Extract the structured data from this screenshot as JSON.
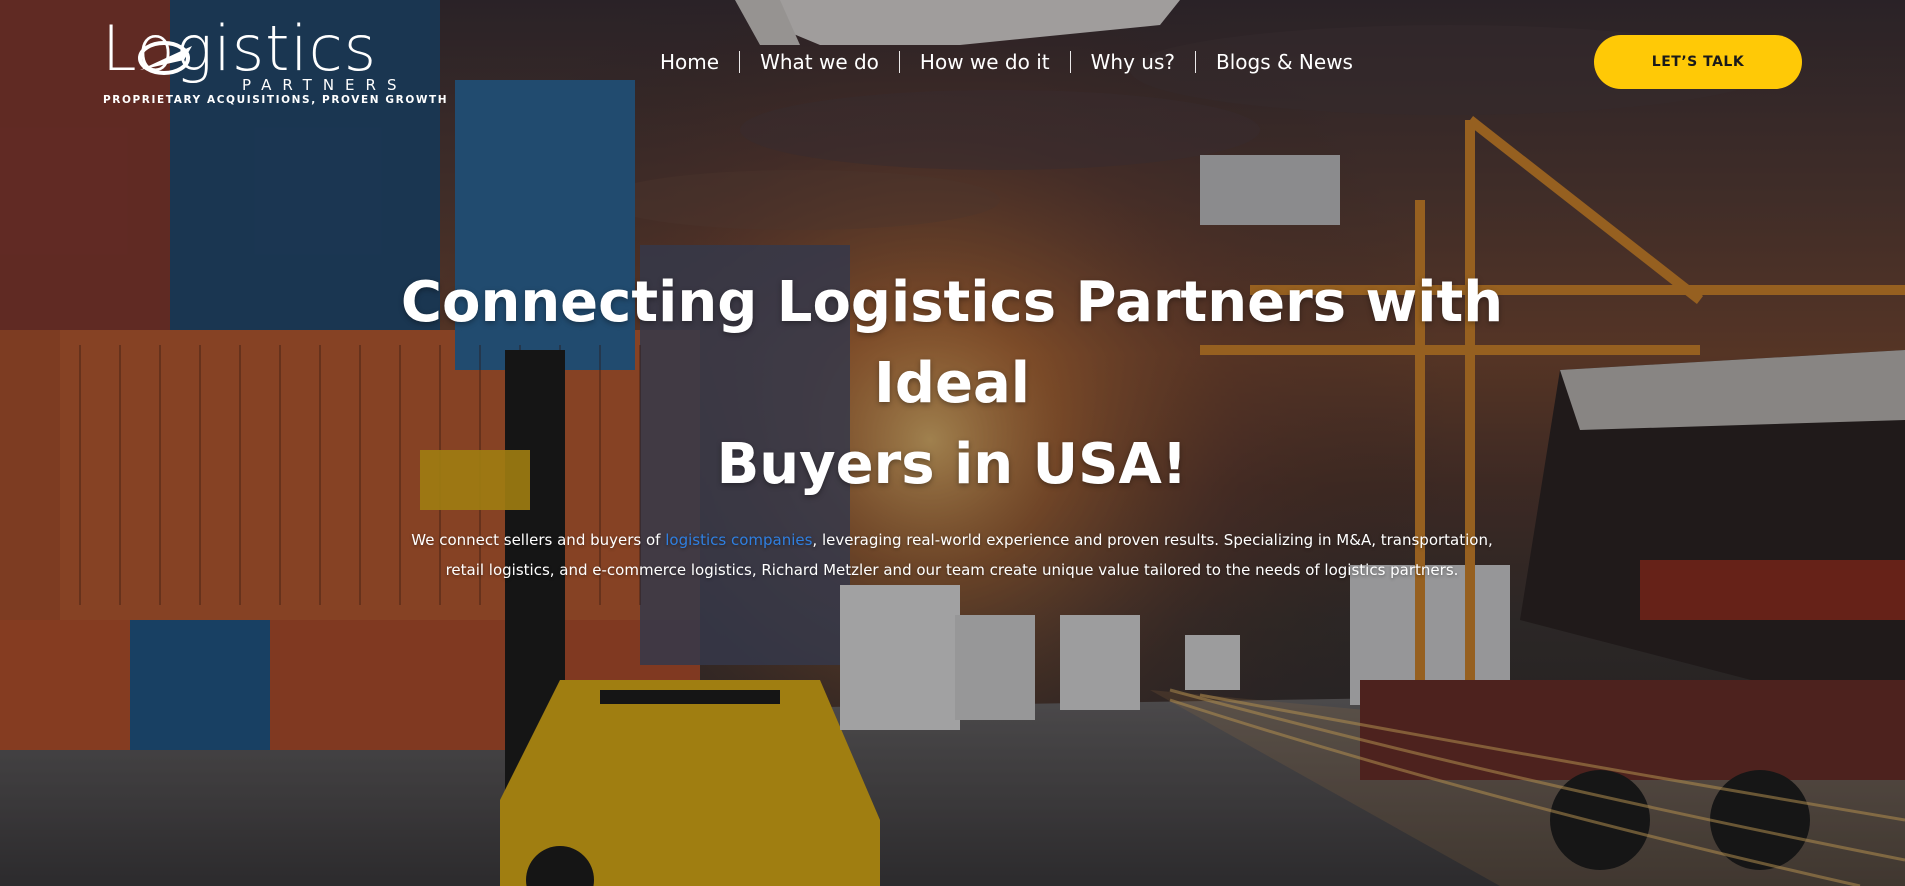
{
  "logo": {
    "wordmark": "Logistics",
    "subtitle": "PARTNERS",
    "tagline": "PROPRIETARY ACQUISITIONS, PROVEN GROWTH",
    "icon": "swoosh-plane-icon"
  },
  "nav": {
    "items": [
      {
        "label": "Home"
      },
      {
        "label": "What we do"
      },
      {
        "label": "How we do it"
      },
      {
        "label": "Why us?"
      },
      {
        "label": "Blogs & News"
      }
    ]
  },
  "cta": {
    "label": "LET’S TALK",
    "color": "#ffc906"
  },
  "hero": {
    "headline_line1": "Connecting Logistics Partners with",
    "headline_line2": "Ideal",
    "headline_line3": "Buyers in USA!",
    "sub_before": "We connect sellers and buyers of ",
    "sub_link": "logistics companies",
    "sub_after": ", leveraging real-world experience and proven results. Specializing in M&A, transportation, retail logistics, and e-commerce logistics, Richard Metzler and our team create unique value tailored to the needs of logistics partners.",
    "link_color": "#2f7fe0"
  }
}
